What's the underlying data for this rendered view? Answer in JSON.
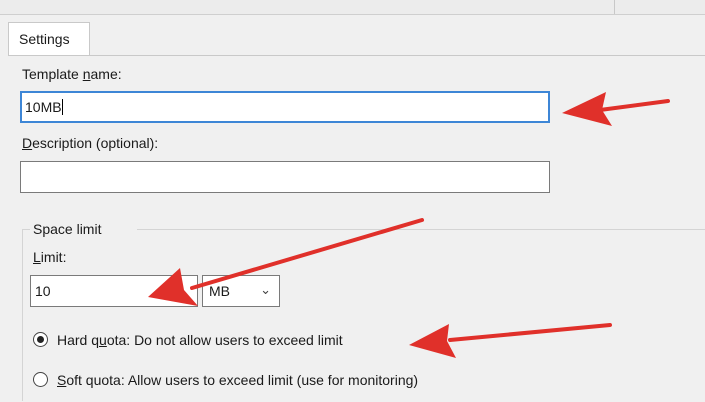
{
  "tab": {
    "label": "Settings"
  },
  "template_name": {
    "label_pre": "Template ",
    "label_key": "n",
    "label_post": "ame:",
    "value": "10MB"
  },
  "description": {
    "label_key": "D",
    "label_post": "escription (optional):",
    "value": ""
  },
  "space_limit": {
    "group_label": "Space limit",
    "limit_label_key": "L",
    "limit_label_post": "imit:",
    "limit_value": "10",
    "unit_selected": "MB"
  },
  "hard_quota": {
    "label_pre": "Hard q",
    "label_key": "u",
    "label_post": "ota: Do not allow users to exceed limit",
    "selected": true
  },
  "soft_quota": {
    "label_key": "S",
    "label_post": "oft quota: Allow users to exceed limit (use for monitoring)",
    "selected": false
  },
  "colors": {
    "arrow": "#e0302a",
    "focus_border": "#3d86d6"
  },
  "icons": {
    "unit_dropdown": "chevron-down-icon"
  }
}
